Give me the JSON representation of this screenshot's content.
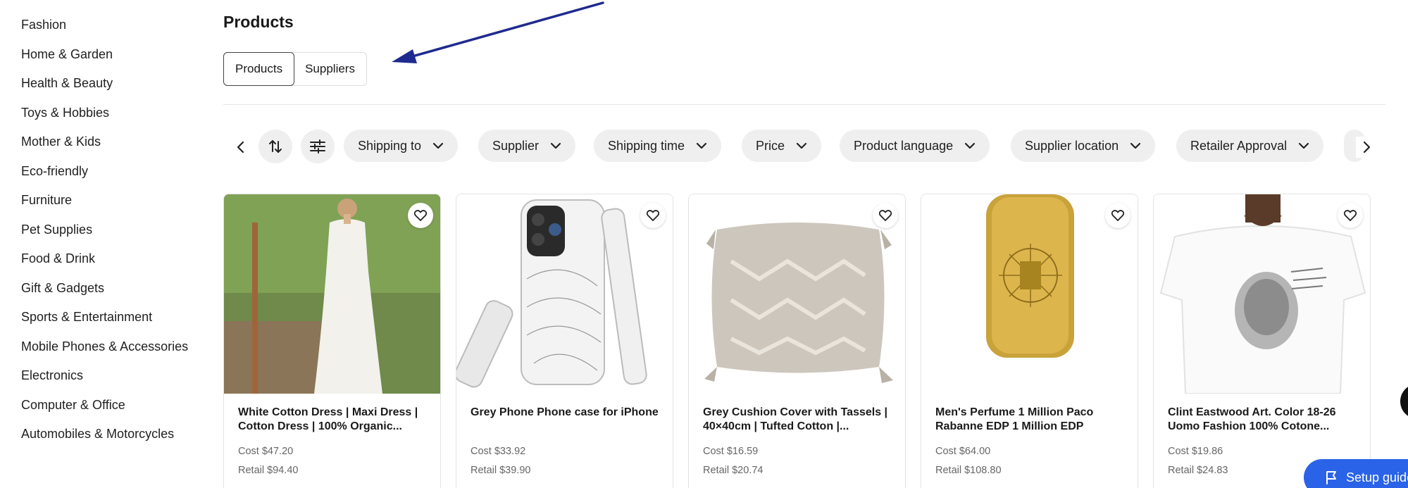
{
  "sidebar": {
    "items": [
      {
        "label": "Fashion"
      },
      {
        "label": "Home & Garden"
      },
      {
        "label": "Health & Beauty"
      },
      {
        "label": "Toys & Hobbies"
      },
      {
        "label": "Mother & Kids"
      },
      {
        "label": "Eco-friendly"
      },
      {
        "label": "Furniture"
      },
      {
        "label": "Pet Supplies"
      },
      {
        "label": "Food & Drink"
      },
      {
        "label": "Gift & Gadgets"
      },
      {
        "label": "Sports & Entertainment"
      },
      {
        "label": "Mobile Phones & Accessories"
      },
      {
        "label": "Electronics"
      },
      {
        "label": "Computer & Office"
      },
      {
        "label": "Automobiles & Motorcycles"
      }
    ]
  },
  "main": {
    "title": "Products",
    "tabs": [
      {
        "label": "Products",
        "active": true
      },
      {
        "label": "Suppliers",
        "active": false
      }
    ]
  },
  "filters": {
    "prev_icon": "chevron-left-icon",
    "next_icon": "chevron-right-icon",
    "sort_icon": "sort-icon",
    "settings_icon": "sliders-icon",
    "chips": [
      {
        "label": "Shipping to"
      },
      {
        "label": "Supplier"
      },
      {
        "label": "Shipping time"
      },
      {
        "label": "Price"
      },
      {
        "label": "Product language"
      },
      {
        "label": "Supplier location"
      },
      {
        "label": "Retailer Approval"
      }
    ]
  },
  "products": [
    {
      "title": "White Cotton Dress | Maxi Dress | Cotton Dress | 100% Organic...",
      "cost": "Cost $47.20",
      "retail": "Retail $94.40"
    },
    {
      "title": "Grey Phone Phone case for iPhone",
      "cost": "Cost $33.92",
      "retail": "Retail $39.90"
    },
    {
      "title": "Grey Cushion Cover with Tassels | 40×40cm | Tufted Cotton |...",
      "cost": "Cost $16.59",
      "retail": "Retail $20.74"
    },
    {
      "title": "Men's Perfume 1 Million Paco Rabanne EDP 1 Million EDP",
      "cost": "Cost $64.00",
      "retail": "Retail $108.80"
    },
    {
      "title": "Clint Eastwood Art. Color 18-26 Uomo Fashion 100% Cotone...",
      "cost": "Cost $19.86",
      "retail": "Retail $24.83"
    }
  ],
  "setup_button": {
    "label": "Setup guide"
  },
  "colors": {
    "accent": "#2a63e8",
    "annotation_arrow": "#1f2a8f",
    "chip_bg": "#efefef"
  }
}
